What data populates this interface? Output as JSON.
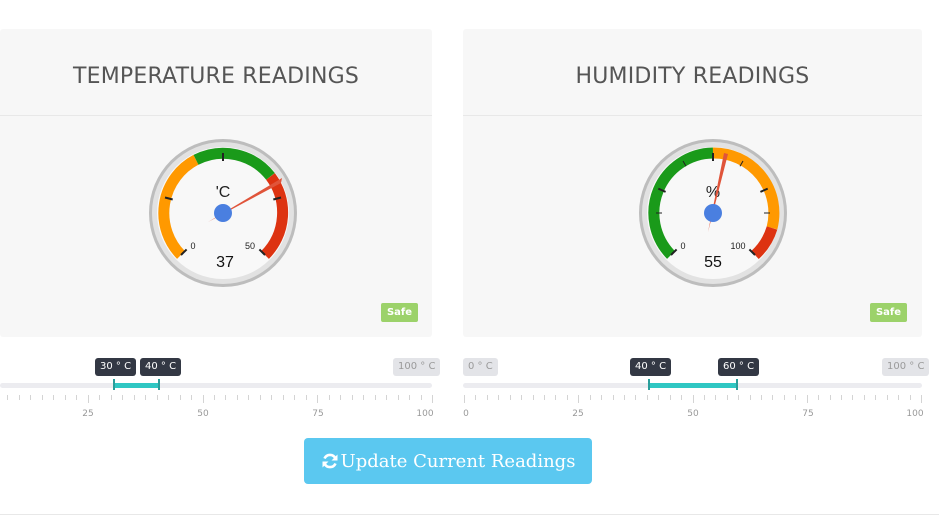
{
  "temperature": {
    "title": "TEMPERATURE READINGS",
    "unit": "'C",
    "value": "37",
    "min": "0",
    "max": "50",
    "badge": "Safe",
    "slider": {
      "low_label": "30 ° C",
      "high_label": "40 ° C",
      "max_label": "100 ° C",
      "low": 30,
      "high": 40,
      "tick_labels": [
        "25",
        "50",
        "75",
        "100"
      ]
    }
  },
  "humidity": {
    "title": "HUMIDITY READINGS",
    "unit": "%",
    "value": "55",
    "min": "0",
    "max": "100",
    "badge": "Safe",
    "slider": {
      "min_label": "0 ° C",
      "low_label": "40 ° C",
      "high_label": "60 ° C",
      "max_label": "100 ° C",
      "low": 40,
      "high": 60,
      "tick_labels": [
        "0",
        "25",
        "50",
        "75",
        "100"
      ]
    }
  },
  "actions": {
    "update_label": "Update Current Readings",
    "update_icon": "refresh-icon"
  },
  "colors": {
    "green": "#1a9a1a",
    "orange": "#ff9900",
    "red": "#dd3311",
    "teal": "#2fc7c3",
    "button": "#5bc8f0",
    "badge": "#9cd26a",
    "needle": "#e0543a",
    "hub": "#4a7fe0"
  }
}
